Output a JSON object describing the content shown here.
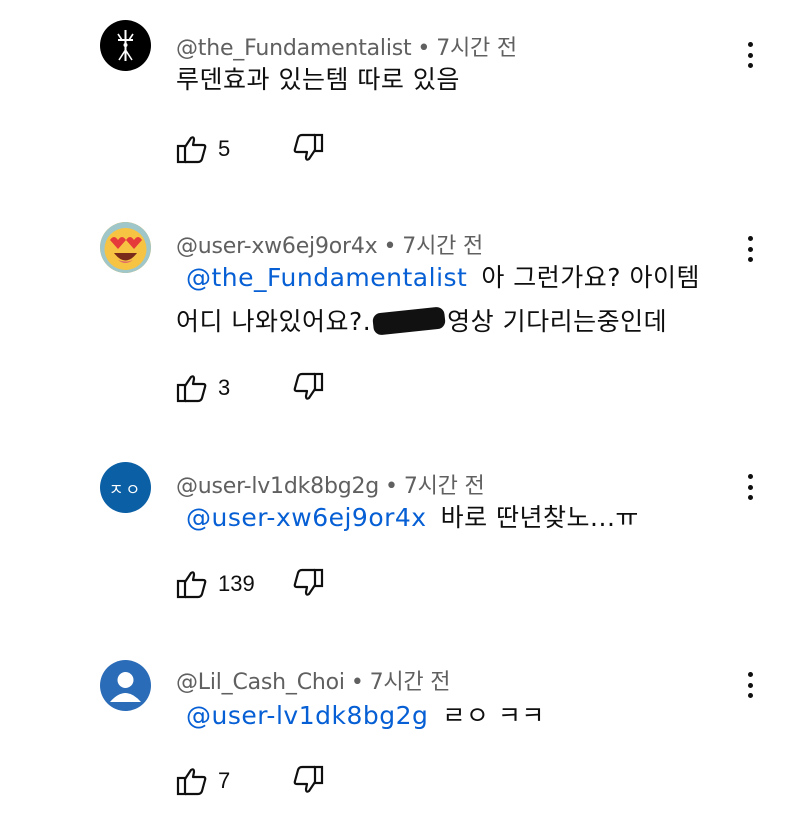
{
  "comments": [
    {
      "author": "@the_Fundamentalist",
      "time": "7시간 전",
      "mention": "",
      "text": "루덴효과 있는템 따로 있음",
      "text2": "",
      "likes": "5"
    },
    {
      "author": "@user-xw6ej9or4x",
      "time": "7시간 전",
      "mention": "@the_Fundamentalist",
      "text": "아 그런가요? 아이템",
      "text2a": "어디 나와있어요?.",
      "text2b": "영상 기다리는중인데",
      "likes": "3"
    },
    {
      "author": "@user-lv1dk8bg2g",
      "time": "7시간 전",
      "mention": "@user-xw6ej9or4x",
      "text": "바로 딴년찾노...ㅠ",
      "likes": "139",
      "avatar_text": "ㅈㅇ"
    },
    {
      "author": "@Lil_Cash_Choi",
      "time": "7시간 전",
      "mention": "@user-lv1dk8bg2g",
      "text": "ㄹㅇ ㅋㅋ",
      "likes": "7"
    }
  ],
  "colors": {
    "mention": "#065fd4",
    "meta": "#606060",
    "avatar_blue": "#0b5fa5",
    "avatar_default": "#2b6cb8"
  },
  "icons": [
    "thumbs-up-icon",
    "thumbs-down-icon",
    "more-vert-icon"
  ]
}
